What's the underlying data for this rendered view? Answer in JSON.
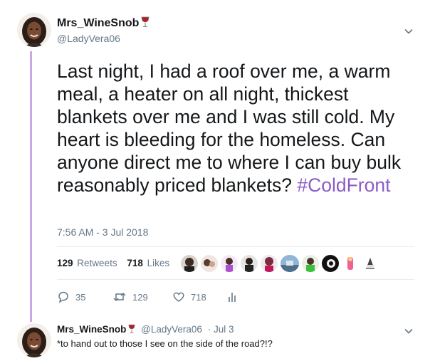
{
  "tweet": {
    "author_name": "Mrs_WineSnob",
    "author_handle": "@LadyVera06",
    "text": "Last night, I had a roof over me, a warm meal, a heater on all night, thickest blankets over me and I was still cold. My heart is bleeding for the homeless. Can anyone direct me to where I can buy bulk reasonably priced blankets? ",
    "hashtag": "#ColdFront",
    "timestamp": "7:56 AM - 3 Jul 2018"
  },
  "stats": {
    "retweets_count": "129",
    "retweets_label": "Retweets",
    "likes_count": "718",
    "likes_label": "Likes"
  },
  "actions": {
    "replies": "35",
    "retweets": "129",
    "likes": "718"
  },
  "reply": {
    "author_name": "Mrs_WineSnob",
    "author_handle": "@LadyVera06",
    "separator": "·",
    "date": "Jul 3",
    "text": "*to hand out to those I see on the side of the road?!?"
  },
  "icons": {
    "caret": "chevron-down-icon",
    "reply": "reply-icon",
    "retweet": "retweet-icon",
    "like": "heart-icon",
    "analytics": "analytics-icon",
    "badge": "wine-glass-icon"
  },
  "colors": {
    "hashtag": "#8b5bc8",
    "thread_line": "#c9a8e8",
    "secondary_text": "#657786",
    "primary_text": "#14171a",
    "wine": "#b0202a"
  }
}
